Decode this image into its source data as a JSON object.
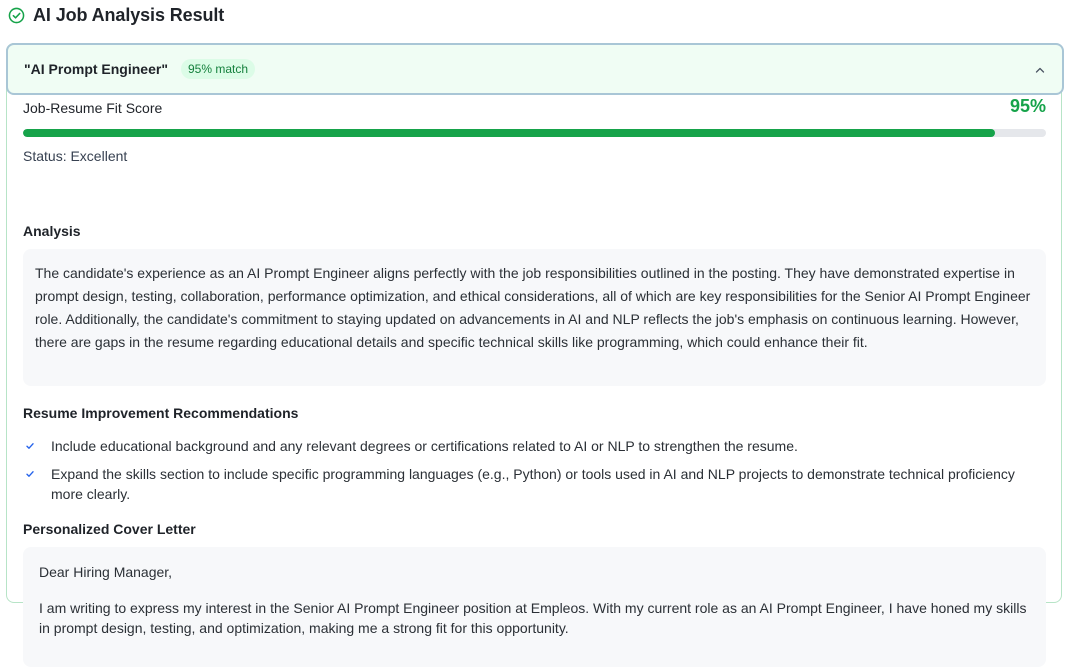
{
  "header": {
    "title": "AI Job Analysis Result",
    "icon": "check-circle-icon"
  },
  "job": {
    "title": "\"AI Prompt Engineer\"",
    "match_badge": "95% match",
    "collapse_icon": "chevron-up-icon"
  },
  "fit": {
    "label": "Job-Resume Fit Score",
    "score_text": "95%",
    "score": 95,
    "status": "Status: Excellent"
  },
  "analysis": {
    "title": "Analysis",
    "text": "The candidate's experience as an AI Prompt Engineer aligns perfectly with the job responsibilities outlined in the posting. They have demonstrated expertise in prompt design, testing, collaboration, performance optimization, and ethical considerations, all of which are key responsibilities for the Senior AI Prompt Engineer role. Additionally, the candidate's commitment to staying updated on advancements in AI and NLP reflects the job's emphasis on continuous learning. However, there are gaps in the resume regarding educational details and specific technical skills like programming, which could enhance their fit."
  },
  "recommendations": {
    "title": "Resume Improvement Recommendations",
    "items": [
      "Include educational background and any relevant degrees or certifications related to AI or NLP to strengthen the resume.",
      "Expand the skills section to include specific programming languages (e.g., Python) or tools used in AI and NLP projects to demonstrate technical proficiency more clearly."
    ]
  },
  "cover_letter": {
    "title": "Personalized Cover Letter",
    "greeting": "Dear Hiring Manager,",
    "body": "I am writing to express my interest in the Senior AI Prompt Engineer position at Empleos. With my current role as an AI Prompt Engineer, I have honed my skills in prompt design, testing, and optimization, making me a strong fit for this opportunity."
  },
  "colors": {
    "accent_green": "#16a34a",
    "badge_bg": "#dcfce7",
    "header_bg": "#f0fdf4",
    "panel_border": "#b7e4c7"
  }
}
